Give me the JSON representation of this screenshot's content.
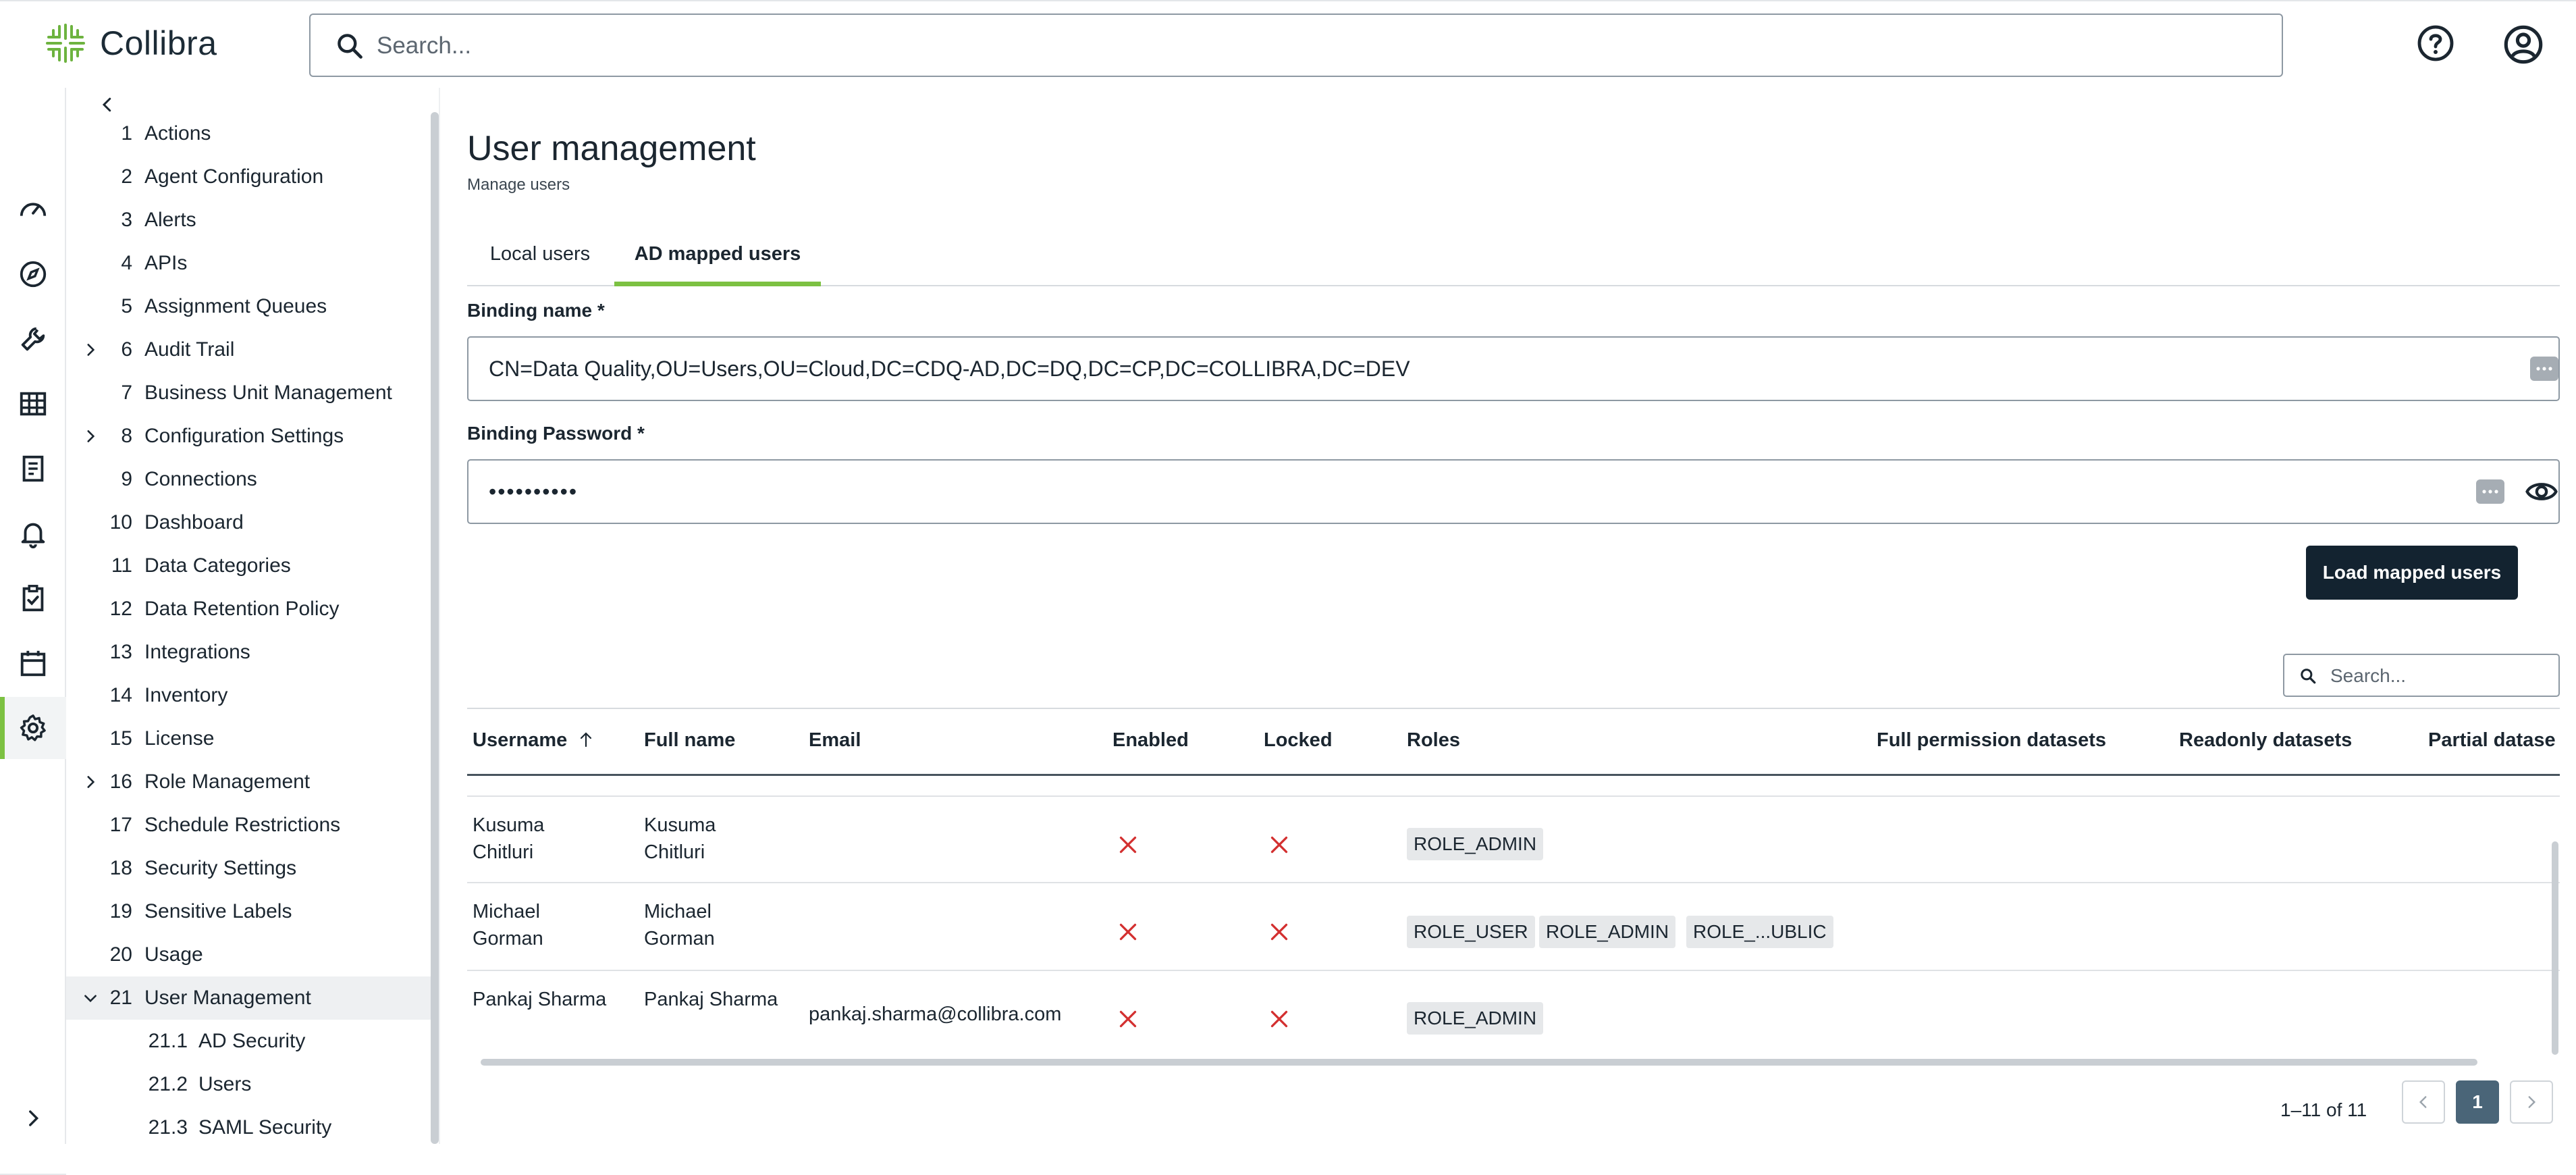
{
  "app": {
    "brand": "Collibra",
    "search_placeholder": "Search...",
    "accent_color": "#7cc142",
    "icons": [
      "help-circle-icon",
      "user-circle-icon"
    ]
  },
  "rail": {
    "items": [
      "dashboard-gauge-icon",
      "compass-icon",
      "wrench-icon",
      "table-grid-icon",
      "report-icon",
      "bell-icon",
      "clipboard-check-icon",
      "calendar-icon",
      "gear-icon"
    ],
    "active": "gear-icon"
  },
  "tree": {
    "items": [
      {
        "num": "1",
        "label": "Actions"
      },
      {
        "num": "2",
        "label": "Agent Configuration"
      },
      {
        "num": "3",
        "label": "Alerts"
      },
      {
        "num": "4",
        "label": "APIs"
      },
      {
        "num": "5",
        "label": "Assignment Queues"
      },
      {
        "num": "6",
        "label": "Audit Trail"
      },
      {
        "num": "7",
        "label": "Business Unit Management"
      },
      {
        "num": "8",
        "label": "Configuration Settings"
      },
      {
        "num": "9",
        "label": "Connections"
      },
      {
        "num": "10",
        "label": "Dashboard"
      },
      {
        "num": "11",
        "label": "Data Categories"
      },
      {
        "num": "12",
        "label": "Data Retention Policy"
      },
      {
        "num": "13",
        "label": "Integrations"
      },
      {
        "num": "14",
        "label": "Inventory"
      },
      {
        "num": "15",
        "label": "License"
      },
      {
        "num": "16",
        "label": "Role Management"
      },
      {
        "num": "17",
        "label": "Schedule Restrictions"
      },
      {
        "num": "18",
        "label": "Security Settings"
      },
      {
        "num": "19",
        "label": "Sensitive Labels"
      },
      {
        "num": "20",
        "label": "Usage"
      },
      {
        "num": "21",
        "label": "User Management"
      },
      {
        "num": "21.1",
        "label": "AD Security"
      },
      {
        "num": "21.2",
        "label": "Users"
      },
      {
        "num": "21.3",
        "label": "SAML Security"
      }
    ],
    "selected": "User Management"
  },
  "page": {
    "title": "User management",
    "subtitle": "Manage users",
    "tabs": [
      {
        "label": "Local users"
      },
      {
        "label": "AD mapped users"
      }
    ],
    "active_tab": "AD mapped users"
  },
  "form": {
    "binding_name_label": "Binding name *",
    "binding_name_value": "CN=Data Quality,OU=Users,OU=Cloud,DC=CDQ-AD,DC=DQ,DC=CP,DC=COLLIBRA,DC=DEV",
    "binding_password_label": "Binding Password *",
    "binding_password_value": "••••••••••",
    "load_button": "Load mapped users"
  },
  "table": {
    "search_placeholder": "Search...",
    "columns": {
      "username": "Username",
      "full_name": "Full name",
      "email": "Email",
      "enabled": "Enabled",
      "locked": "Locked",
      "roles": "Roles",
      "full_permission": "Full permission datasets",
      "readonly": "Readonly datasets",
      "partial": "Partial datase"
    },
    "sort": "Username ascending",
    "rows": [
      {
        "username": "Kusuma Chitluri",
        "full_name": "Kusuma Chitluri",
        "email": "",
        "enabled": false,
        "locked": false,
        "roles": [
          "ROLE_ADMIN"
        ]
      },
      {
        "username": "Michael Gorman",
        "full_name": "Michael Gorman",
        "email": "",
        "enabled": false,
        "locked": false,
        "roles": [
          "ROLE_USER",
          "ROLE_ADMIN",
          "ROLE_...UBLIC"
        ]
      },
      {
        "username": "Pankaj Sharma",
        "full_name": "Pankaj Sharma",
        "email": "pankaj.sharma@collibra.com",
        "enabled": false,
        "locked": false,
        "roles": [
          "ROLE_ADMIN"
        ]
      }
    ],
    "false_mark_color": "#d32f2f",
    "pagination": {
      "range": "1–11 of 11",
      "current_page": "1"
    }
  }
}
